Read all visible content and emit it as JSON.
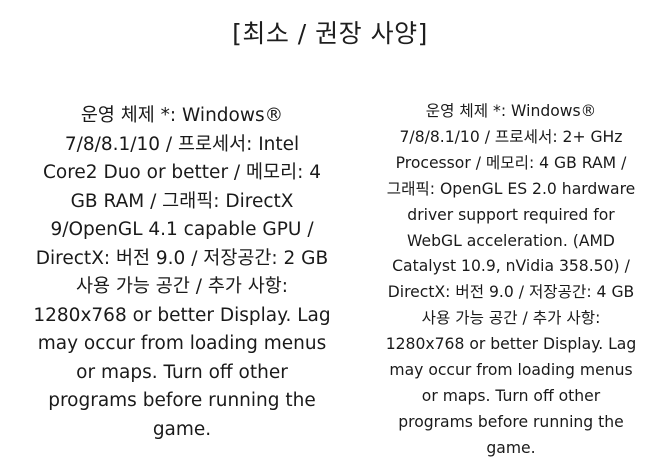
{
  "title": "[최소 / 권장 사양]",
  "minimum": {
    "text": "운영 체제 *: Windows®\n7/8/8.1/10 / 프로세서: Intel\nCore2 Duo or better / 메모리: 4\nGB RAM / 그래픽: DirectX\n9/OpenGL 4.1 capable GPU /\nDirectX: 버전 9.0 / 저장공간: 2 GB\n사용 가능 공간 / 추가 사항:\n1280x768 or better Display. Lag\nmay occur from loading menus\nor maps. Turn off other\nprograms before running the\ngame."
  },
  "recommended": {
    "text": "운영 체제 *: Windows®\n7/8/8.1/10 / 프로세서: 2+ GHz\nProcessor / 메모리: 4 GB RAM /\n그래픽: OpenGL ES 2.0 hardware\ndriver support required for\nWebGL acceleration. (AMD\nCatalyst 10.9, nVidia 358.50) /\nDirectX: 버전 9.0 / 저장공간: 4 GB\n사용 가능 공간 / 추가 사항:\n1280x768 or better Display. Lag\nmay occur from loading menus\nor maps. Turn off other\nprograms before running the\ngame."
  }
}
